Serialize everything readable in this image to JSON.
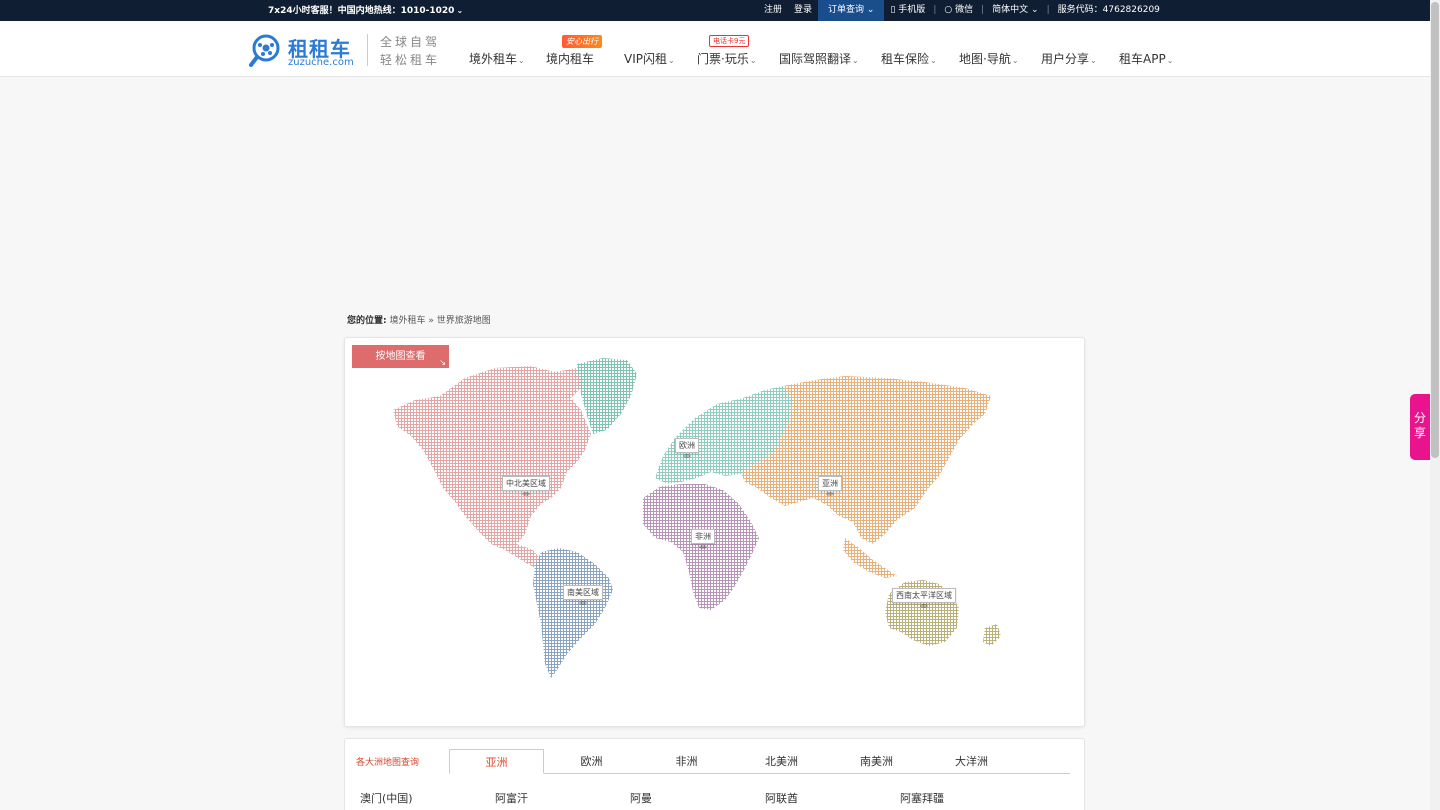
{
  "topbar": {
    "hotline": "7x24小时客服！中国内地热线：1010-1020",
    "register": "注册",
    "login": "登录",
    "order_query": "订单查询",
    "mobile": "手机版",
    "wechat": "微信",
    "language": "简体中文",
    "service_code": "服务代码：4762826209"
  },
  "header": {
    "logo_name": "租租车",
    "logo_domain": "zuzuche.com",
    "slogan_line1": "全球自驾",
    "slogan_line2": "轻松租车",
    "nav": [
      {
        "label": "境外租车",
        "has_arrow": true
      },
      {
        "label": "境内租车",
        "has_arrow": false
      },
      {
        "label": "VIP闪租",
        "has_arrow": true
      },
      {
        "label": "门票·玩乐",
        "has_arrow": true
      },
      {
        "label": "国际驾照翻译",
        "has_arrow": true
      },
      {
        "label": "租车保险",
        "has_arrow": true
      },
      {
        "label": "地图·导航",
        "has_arrow": true
      },
      {
        "label": "用户分享",
        "has_arrow": true
      },
      {
        "label": "租车APP",
        "has_arrow": true
      }
    ],
    "badge_domestic": "安心出行",
    "badge_tickets": "电话卡9元"
  },
  "share_tab": "分享",
  "breadcrumb": {
    "prefix": "您的位置:",
    "home": "境外租车",
    "sep": "»",
    "current": "世界旅游地图"
  },
  "map": {
    "button": "按地图查看",
    "regions": [
      "欧洲",
      "亚洲",
      "中北美区域",
      "非洲",
      "南美区域",
      "西南太平洋区域"
    ],
    "colors": {
      "north_america": "#e3a5a5",
      "greenland": "#7fc4b2",
      "europe": "#8fcdc0",
      "asia": "#e9b07a",
      "africa": "#b794b8",
      "south_america": "#8aa4c2",
      "oceania": "#b9b07a"
    }
  },
  "continents": {
    "title": "各大洲地图查询",
    "tabs": [
      "亚洲",
      "欧洲",
      "非洲",
      "北美洲",
      "南美洲",
      "大洋洲"
    ],
    "active": "亚洲",
    "countries": [
      "澳门(中国)",
      "阿富汗",
      "阿曼",
      "阿联酋",
      "阿塞拜疆"
    ]
  }
}
